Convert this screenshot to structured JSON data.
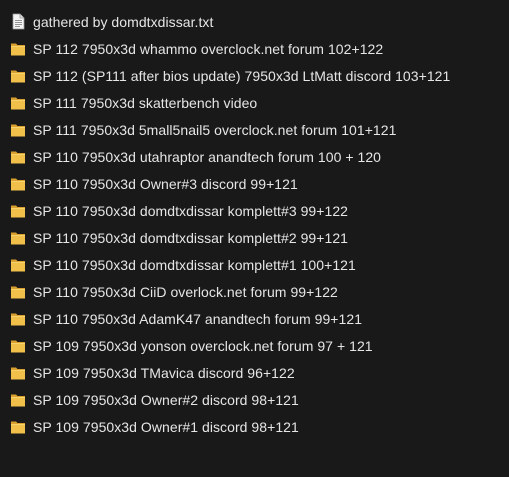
{
  "file_list": {
    "items": [
      {
        "type": "file",
        "icon": "text-file-icon",
        "name": "gathered by domdtxdissar.txt"
      },
      {
        "type": "folder",
        "icon": "folder-icon",
        "name": "SP 112 7950x3d whammo overclock.net forum 102+122"
      },
      {
        "type": "folder",
        "icon": "folder-icon",
        "name": "SP 112 (SP111 after bios update) 7950x3d LtMatt discord 103+121"
      },
      {
        "type": "folder",
        "icon": "folder-icon",
        "name": "SP 111 7950x3d skatterbench video"
      },
      {
        "type": "folder",
        "icon": "folder-icon",
        "name": "SP 111 7950x3d 5mall5nail5 overclock.net forum 101+121"
      },
      {
        "type": "folder",
        "icon": "folder-icon",
        "name": "SP 110 7950x3d utahraptor anandtech forum 100 + 120"
      },
      {
        "type": "folder",
        "icon": "folder-icon",
        "name": "SP 110 7950x3d Owner#3 discord 99+121"
      },
      {
        "type": "folder",
        "icon": "folder-icon",
        "name": "SP 110 7950x3d domdtxdissar komplett#3 99+122"
      },
      {
        "type": "folder",
        "icon": "folder-icon",
        "name": "SP 110 7950x3d domdtxdissar komplett#2 99+121"
      },
      {
        "type": "folder",
        "icon": "folder-icon",
        "name": "SP 110 7950x3d domdtxdissar komplett#1 100+121"
      },
      {
        "type": "folder",
        "icon": "folder-icon",
        "name": "SP 110 7950x3d CiiD overlock.net forum 99+122"
      },
      {
        "type": "folder",
        "icon": "folder-icon",
        "name": "SP 110 7950x3d AdamK47 anandtech forum 99+121"
      },
      {
        "type": "folder",
        "icon": "folder-icon",
        "name": "SP 109 7950x3d yonson overclock.net forum 97 + 121"
      },
      {
        "type": "folder",
        "icon": "folder-icon",
        "name": "SP 109 7950x3d TMavica discord 96+122"
      },
      {
        "type": "folder",
        "icon": "folder-icon",
        "name": "SP 109 7950x3d Owner#2 discord 98+121"
      },
      {
        "type": "folder",
        "icon": "folder-icon",
        "name": "SP 109 7950x3d Owner#1 discord 98+121"
      }
    ]
  },
  "colors": {
    "background": "#191919",
    "text": "#e6e6e6",
    "folder_fill": "#f0c04a",
    "folder_back": "#d9a02f"
  }
}
